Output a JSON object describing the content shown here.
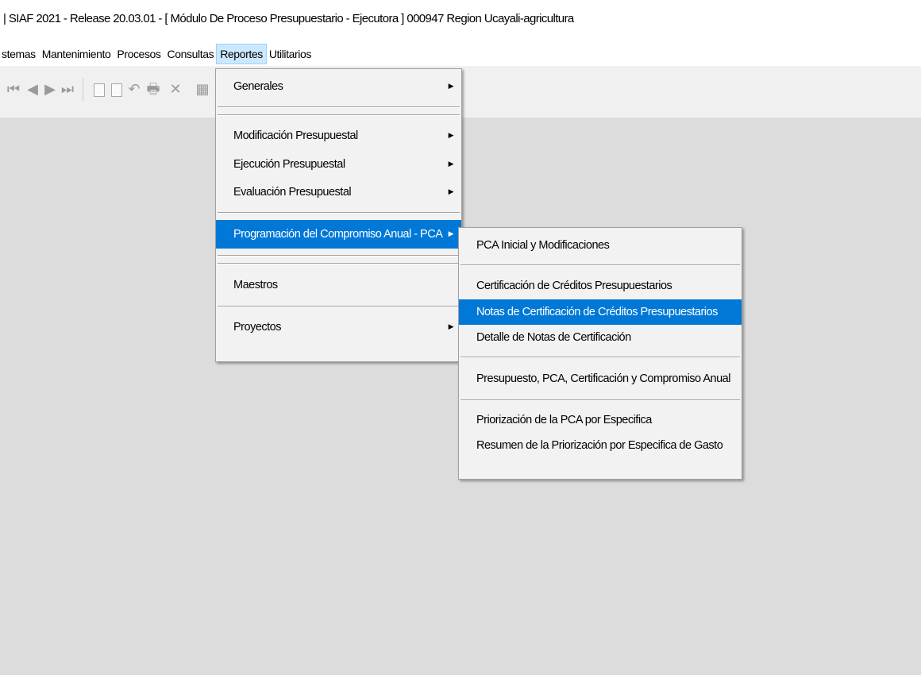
{
  "window": {
    "title": "| SIAF 2021 - Release 20.03.01 - [ Módulo De Proceso Presupuestario - Ejecutora ] 000947 Region Ucayali-agricultura"
  },
  "menubar": {
    "items": [
      "stemas",
      "Mantenimiento",
      "Procesos",
      "Consultas",
      "Reportes",
      "Utilitarios"
    ],
    "active": "Reportes"
  },
  "toolbar": {
    "icons": [
      "first-record-icon",
      "previous-record-icon",
      "next-record-icon",
      "last-record-icon",
      "new-document-icon",
      "copy-icon",
      "undo-icon",
      "print-icon",
      "delete-icon",
      "save-icon"
    ]
  },
  "reportes_menu": {
    "generales": "Generales",
    "modificacion": "Modificación Presupuestal",
    "ejecucion": "Ejecución Presupuestal",
    "evaluacion": "Evaluación Presupuestal",
    "pca": "Programación del Compromiso Anual - PCA",
    "maestros": "Maestros",
    "proyectos": "Proyectos"
  },
  "pca_submenu": {
    "pca_inicial": "PCA Inicial y Modificaciones",
    "certificacion": "Certificación de Créditos Presupuestarios",
    "notas": "Notas de Certificación de Créditos Presupuestarios",
    "detalle": "Detalle de Notas de Certificación",
    "presupuesto": "Presupuesto, PCA, Certificación y Compromiso Anual",
    "priorizacion": "Priorización de la PCA por Especifica",
    "resumen": "Resumen de la Priorización por Especifica de Gasto"
  },
  "colors": {
    "highlight": "#0078d7",
    "menu_bg": "#f2f2f2",
    "workspace_bg": "#dcdcdc"
  }
}
